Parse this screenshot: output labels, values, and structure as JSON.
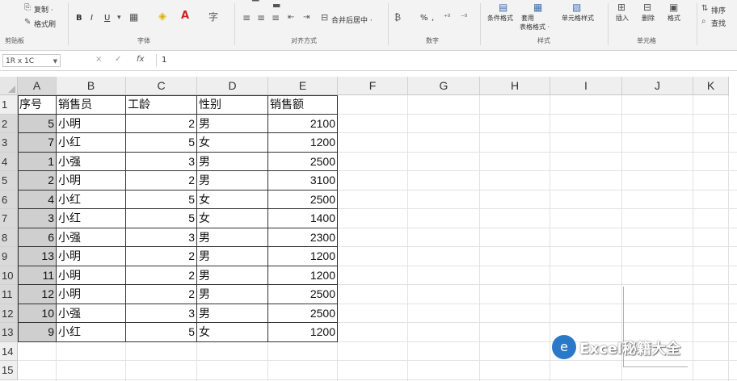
{
  "ribbon": {
    "clipboard": {
      "copy_label": "复制 ·",
      "painter_label": "格式刷",
      "group_label": "剪贴板"
    },
    "font": {
      "group_label": "字体",
      "bold": "B",
      "italic": "I",
      "underline": "U"
    },
    "alignment": {
      "merge_label": "合并后居中 ·",
      "group_label": "对齐方式"
    },
    "number": {
      "percent": "%",
      "comma": ",",
      "group_label": "数字"
    },
    "styles": {
      "cond_format_label": "条件格式",
      "table_format_label": "套用\n表格格式",
      "cell_style_label": "单元格样式",
      "group_label": "样式"
    },
    "cells": {
      "insert_label": "插入",
      "delete_label": "删除",
      "format_label": "格式",
      "group_label": "单元格"
    },
    "editing": {
      "sort_label": "排序",
      "find_label": "查找"
    }
  },
  "formula_bar": {
    "name_box": "1R x 1C",
    "cancel": "×",
    "enter": "✓",
    "fx": "fx",
    "content": "1"
  },
  "columns": [
    "A",
    "B",
    "C",
    "D",
    "E",
    "F",
    "G",
    "H",
    "I",
    "J",
    "K"
  ],
  "rows": [
    "1",
    "2",
    "3",
    "4",
    "5",
    "6",
    "7",
    "8",
    "9",
    "10",
    "11",
    "12",
    "13",
    "14",
    "15"
  ],
  "table": {
    "headers": [
      "序号",
      "销售员",
      "工龄",
      "性别",
      "销售额"
    ],
    "data": [
      [
        "5",
        "小明",
        "2",
        "男",
        "2100"
      ],
      [
        "7",
        "小红",
        "5",
        "女",
        "1200"
      ],
      [
        "1",
        "小强",
        "3",
        "男",
        "2500"
      ],
      [
        "2",
        "小明",
        "2",
        "男",
        "3100"
      ],
      [
        "4",
        "小红",
        "5",
        "女",
        "2500"
      ],
      [
        "3",
        "小红",
        "5",
        "女",
        "1400"
      ],
      [
        "6",
        "小强",
        "3",
        "男",
        "2300"
      ],
      [
        "13",
        "小明",
        "2",
        "男",
        "1200"
      ],
      [
        "11",
        "小明",
        "2",
        "男",
        "1200"
      ],
      [
        "12",
        "小明",
        "2",
        "男",
        "2500"
      ],
      [
        "10",
        "小强",
        "3",
        "男",
        "2500"
      ],
      [
        "9",
        "小红",
        "5",
        "女",
        "1200"
      ]
    ]
  },
  "watermark": {
    "text": "Excel秘籍大全"
  },
  "colors": {
    "selected_fill": "#cfcfcf",
    "header_bg": "#efefef",
    "border": "#333333"
  }
}
